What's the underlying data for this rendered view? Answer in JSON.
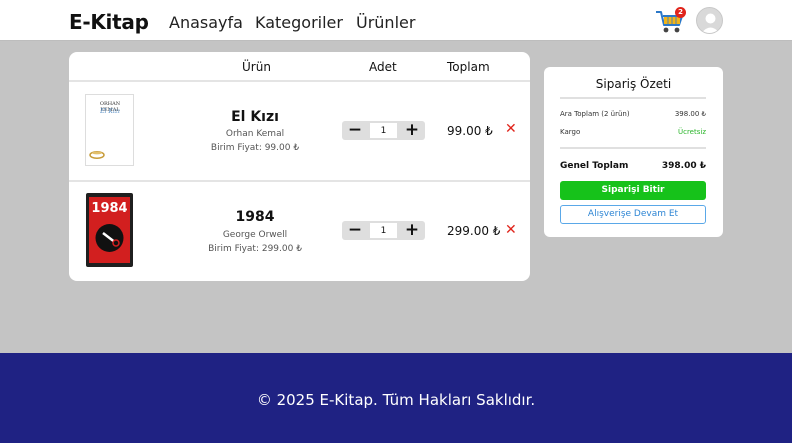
{
  "nav": {
    "brand": "E-Kitap",
    "links": [
      "Anasayfa",
      "Kategoriler",
      "Ürünler"
    ],
    "cart_count": "2"
  },
  "cart": {
    "headers": {
      "product": "Ürün",
      "quantity": "Adet",
      "total": "Toplam"
    },
    "items": [
      {
        "title": "El Kızı",
        "author": "Orhan Kemal",
        "unit_price": "Birim Fiyat: 99.00 ₺",
        "quantity": "1",
        "total": "99.00 ₺",
        "cover_author": "ORHAN KEMAL",
        "cover_title": "El Kızı"
      },
      {
        "title": "1984",
        "author": "George Orwell",
        "unit_price": "Birim Fiyat: 299.00 ₺",
        "quantity": "1",
        "total": "299.00 ₺",
        "cover_title": "1984"
      }
    ]
  },
  "summary": {
    "title": "Sipariş Özeti",
    "subtotal_label": "Ara Toplam (2 ürün)",
    "subtotal_value": "398.00 ₺",
    "shipping_label": "Kargo",
    "shipping_value": "Ücretsiz",
    "grand_label": "Genel Toplam",
    "grand_value": "398.00 ₺",
    "checkout_label": "Siparişi Bitir",
    "continue_label": "Alışverişe Devam Et"
  },
  "footer": {
    "text": "© 2025 E-Kitap. Tüm Hakları Saklıdır."
  },
  "colors": {
    "footer_bg": "#1f2283",
    "checkout_green": "#16c21a",
    "remove_red": "#e0241b",
    "continue_blue": "#2f86d4",
    "page_bg": "#c4c4c4"
  },
  "icons": [
    "shopping-cart-icon",
    "avatar-user-icon",
    "minus-icon",
    "plus-icon",
    "remove-x-icon"
  ]
}
